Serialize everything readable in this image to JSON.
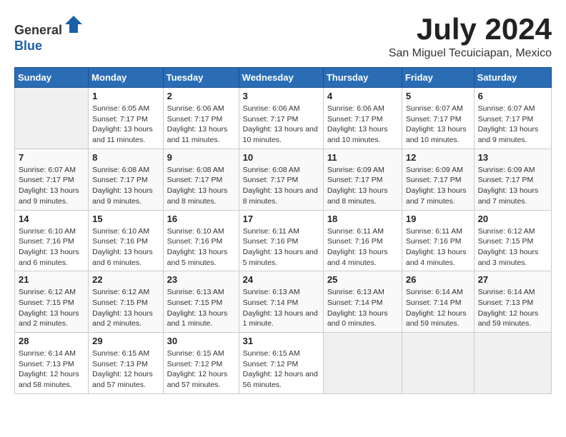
{
  "header": {
    "logo_general": "General",
    "logo_blue": "Blue",
    "month": "July 2024",
    "location": "San Miguel Tecuiciapan, Mexico"
  },
  "weekdays": [
    "Sunday",
    "Monday",
    "Tuesday",
    "Wednesday",
    "Thursday",
    "Friday",
    "Saturday"
  ],
  "weeks": [
    [
      {
        "day": "",
        "empty": true
      },
      {
        "day": "1",
        "sunrise": "Sunrise: 6:05 AM",
        "sunset": "Sunset: 7:17 PM",
        "daylight": "Daylight: 13 hours and 11 minutes."
      },
      {
        "day": "2",
        "sunrise": "Sunrise: 6:06 AM",
        "sunset": "Sunset: 7:17 PM",
        "daylight": "Daylight: 13 hours and 11 minutes."
      },
      {
        "day": "3",
        "sunrise": "Sunrise: 6:06 AM",
        "sunset": "Sunset: 7:17 PM",
        "daylight": "Daylight: 13 hours and 10 minutes."
      },
      {
        "day": "4",
        "sunrise": "Sunrise: 6:06 AM",
        "sunset": "Sunset: 7:17 PM",
        "daylight": "Daylight: 13 hours and 10 minutes."
      },
      {
        "day": "5",
        "sunrise": "Sunrise: 6:07 AM",
        "sunset": "Sunset: 7:17 PM",
        "daylight": "Daylight: 13 hours and 10 minutes."
      },
      {
        "day": "6",
        "sunrise": "Sunrise: 6:07 AM",
        "sunset": "Sunset: 7:17 PM",
        "daylight": "Daylight: 13 hours and 9 minutes."
      }
    ],
    [
      {
        "day": "7",
        "sunrise": "Sunrise: 6:07 AM",
        "sunset": "Sunset: 7:17 PM",
        "daylight": "Daylight: 13 hours and 9 minutes."
      },
      {
        "day": "8",
        "sunrise": "Sunrise: 6:08 AM",
        "sunset": "Sunset: 7:17 PM",
        "daylight": "Daylight: 13 hours and 9 minutes."
      },
      {
        "day": "9",
        "sunrise": "Sunrise: 6:08 AM",
        "sunset": "Sunset: 7:17 PM",
        "daylight": "Daylight: 13 hours and 8 minutes."
      },
      {
        "day": "10",
        "sunrise": "Sunrise: 6:08 AM",
        "sunset": "Sunset: 7:17 PM",
        "daylight": "Daylight: 13 hours and 8 minutes."
      },
      {
        "day": "11",
        "sunrise": "Sunrise: 6:09 AM",
        "sunset": "Sunset: 7:17 PM",
        "daylight": "Daylight: 13 hours and 8 minutes."
      },
      {
        "day": "12",
        "sunrise": "Sunrise: 6:09 AM",
        "sunset": "Sunset: 7:17 PM",
        "daylight": "Daylight: 13 hours and 7 minutes."
      },
      {
        "day": "13",
        "sunrise": "Sunrise: 6:09 AM",
        "sunset": "Sunset: 7:17 PM",
        "daylight": "Daylight: 13 hours and 7 minutes."
      }
    ],
    [
      {
        "day": "14",
        "sunrise": "Sunrise: 6:10 AM",
        "sunset": "Sunset: 7:16 PM",
        "daylight": "Daylight: 13 hours and 6 minutes."
      },
      {
        "day": "15",
        "sunrise": "Sunrise: 6:10 AM",
        "sunset": "Sunset: 7:16 PM",
        "daylight": "Daylight: 13 hours and 6 minutes."
      },
      {
        "day": "16",
        "sunrise": "Sunrise: 6:10 AM",
        "sunset": "Sunset: 7:16 PM",
        "daylight": "Daylight: 13 hours and 5 minutes."
      },
      {
        "day": "17",
        "sunrise": "Sunrise: 6:11 AM",
        "sunset": "Sunset: 7:16 PM",
        "daylight": "Daylight: 13 hours and 5 minutes."
      },
      {
        "day": "18",
        "sunrise": "Sunrise: 6:11 AM",
        "sunset": "Sunset: 7:16 PM",
        "daylight": "Daylight: 13 hours and 4 minutes."
      },
      {
        "day": "19",
        "sunrise": "Sunrise: 6:11 AM",
        "sunset": "Sunset: 7:16 PM",
        "daylight": "Daylight: 13 hours and 4 minutes."
      },
      {
        "day": "20",
        "sunrise": "Sunrise: 6:12 AM",
        "sunset": "Sunset: 7:15 PM",
        "daylight": "Daylight: 13 hours and 3 minutes."
      }
    ],
    [
      {
        "day": "21",
        "sunrise": "Sunrise: 6:12 AM",
        "sunset": "Sunset: 7:15 PM",
        "daylight": "Daylight: 13 hours and 2 minutes."
      },
      {
        "day": "22",
        "sunrise": "Sunrise: 6:12 AM",
        "sunset": "Sunset: 7:15 PM",
        "daylight": "Daylight: 13 hours and 2 minutes."
      },
      {
        "day": "23",
        "sunrise": "Sunrise: 6:13 AM",
        "sunset": "Sunset: 7:15 PM",
        "daylight": "Daylight: 13 hours and 1 minute."
      },
      {
        "day": "24",
        "sunrise": "Sunrise: 6:13 AM",
        "sunset": "Sunset: 7:14 PM",
        "daylight": "Daylight: 13 hours and 1 minute."
      },
      {
        "day": "25",
        "sunrise": "Sunrise: 6:13 AM",
        "sunset": "Sunset: 7:14 PM",
        "daylight": "Daylight: 13 hours and 0 minutes."
      },
      {
        "day": "26",
        "sunrise": "Sunrise: 6:14 AM",
        "sunset": "Sunset: 7:14 PM",
        "daylight": "Daylight: 12 hours and 59 minutes."
      },
      {
        "day": "27",
        "sunrise": "Sunrise: 6:14 AM",
        "sunset": "Sunset: 7:13 PM",
        "daylight": "Daylight: 12 hours and 59 minutes."
      }
    ],
    [
      {
        "day": "28",
        "sunrise": "Sunrise: 6:14 AM",
        "sunset": "Sunset: 7:13 PM",
        "daylight": "Daylight: 12 hours and 58 minutes."
      },
      {
        "day": "29",
        "sunrise": "Sunrise: 6:15 AM",
        "sunset": "Sunset: 7:13 PM",
        "daylight": "Daylight: 12 hours and 57 minutes."
      },
      {
        "day": "30",
        "sunrise": "Sunrise: 6:15 AM",
        "sunset": "Sunset: 7:12 PM",
        "daylight": "Daylight: 12 hours and 57 minutes."
      },
      {
        "day": "31",
        "sunrise": "Sunrise: 6:15 AM",
        "sunset": "Sunset: 7:12 PM",
        "daylight": "Daylight: 12 hours and 56 minutes."
      },
      {
        "day": "",
        "empty": true
      },
      {
        "day": "",
        "empty": true
      },
      {
        "day": "",
        "empty": true
      }
    ]
  ]
}
